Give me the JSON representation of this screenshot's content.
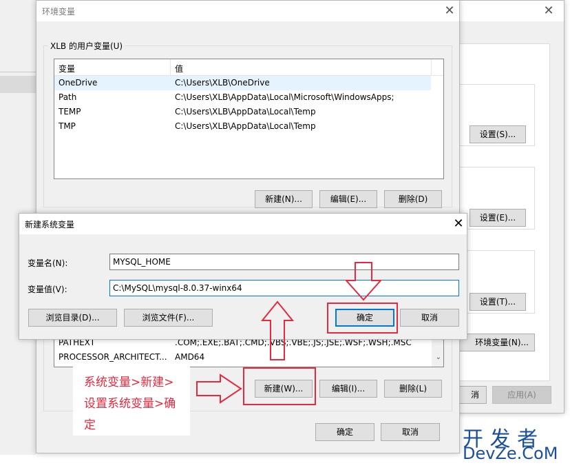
{
  "bg_window": {
    "settings_buttons": [
      "设置(S)...",
      "设置(E)...",
      "设置(T)..."
    ],
    "env_button": "环境变量(N)...",
    "cancel_partial": "消",
    "apply_button": "应用(A)"
  },
  "env_dialog": {
    "title": "环境变量",
    "user_group_label": "XLB 的用户变量(U)",
    "columns": [
      "变量",
      "值"
    ],
    "user_vars": [
      {
        "name": "OneDrive",
        "value": "C:\\Users\\XLB\\OneDrive"
      },
      {
        "name": "Path",
        "value": "C:\\Users\\XLB\\AppData\\Local\\Microsoft\\WindowsApps;"
      },
      {
        "name": "TEMP",
        "value": "C:\\Users\\XLB\\AppData\\Local\\Temp"
      },
      {
        "name": "TMP",
        "value": "C:\\Users\\XLB\\AppData\\Local\\Temp"
      }
    ],
    "user_buttons": [
      "新建(N)...",
      "编辑(E)...",
      "删除(D)"
    ],
    "system_vars_visible": [
      {
        "name": "PATHEXT",
        "value": ".COM;.EXE;.BAT;.CMD;.VBS;.VBE;.JS;.JSE;.WSF;.WSH;.MSC"
      },
      {
        "name": "PROCESSOR_ARCHITECT...",
        "value": "AMD64"
      }
    ],
    "system_buttons": [
      "新建(W)...",
      "编辑(I)...",
      "删除(L)"
    ],
    "ok": "确定",
    "cancel": "取消"
  },
  "new_var_dialog": {
    "title": "新建系统变量",
    "name_label": "变量名(N):",
    "name_value": "MYSQL_HOME",
    "value_label": "变量值(V):",
    "value_value": "C:\\MySQL\\mysql-8.0.37-winx64",
    "browse_dir": "浏览目录(D)...",
    "browse_file": "浏览文件(F)...",
    "ok": "确定",
    "cancel": "取消"
  },
  "annotation": {
    "line1": "系统变量>新建>",
    "line2": "设置系统变量>确",
    "line3": "定",
    "color": "#e8283c"
  },
  "watermark": {
    "cn": "开 发 者",
    "en": "DevZe.CoM"
  },
  "colors": {
    "dialog_bg": "#f0f0f0",
    "accent": "#0078d7",
    "annotation_red": "#e8283c"
  }
}
